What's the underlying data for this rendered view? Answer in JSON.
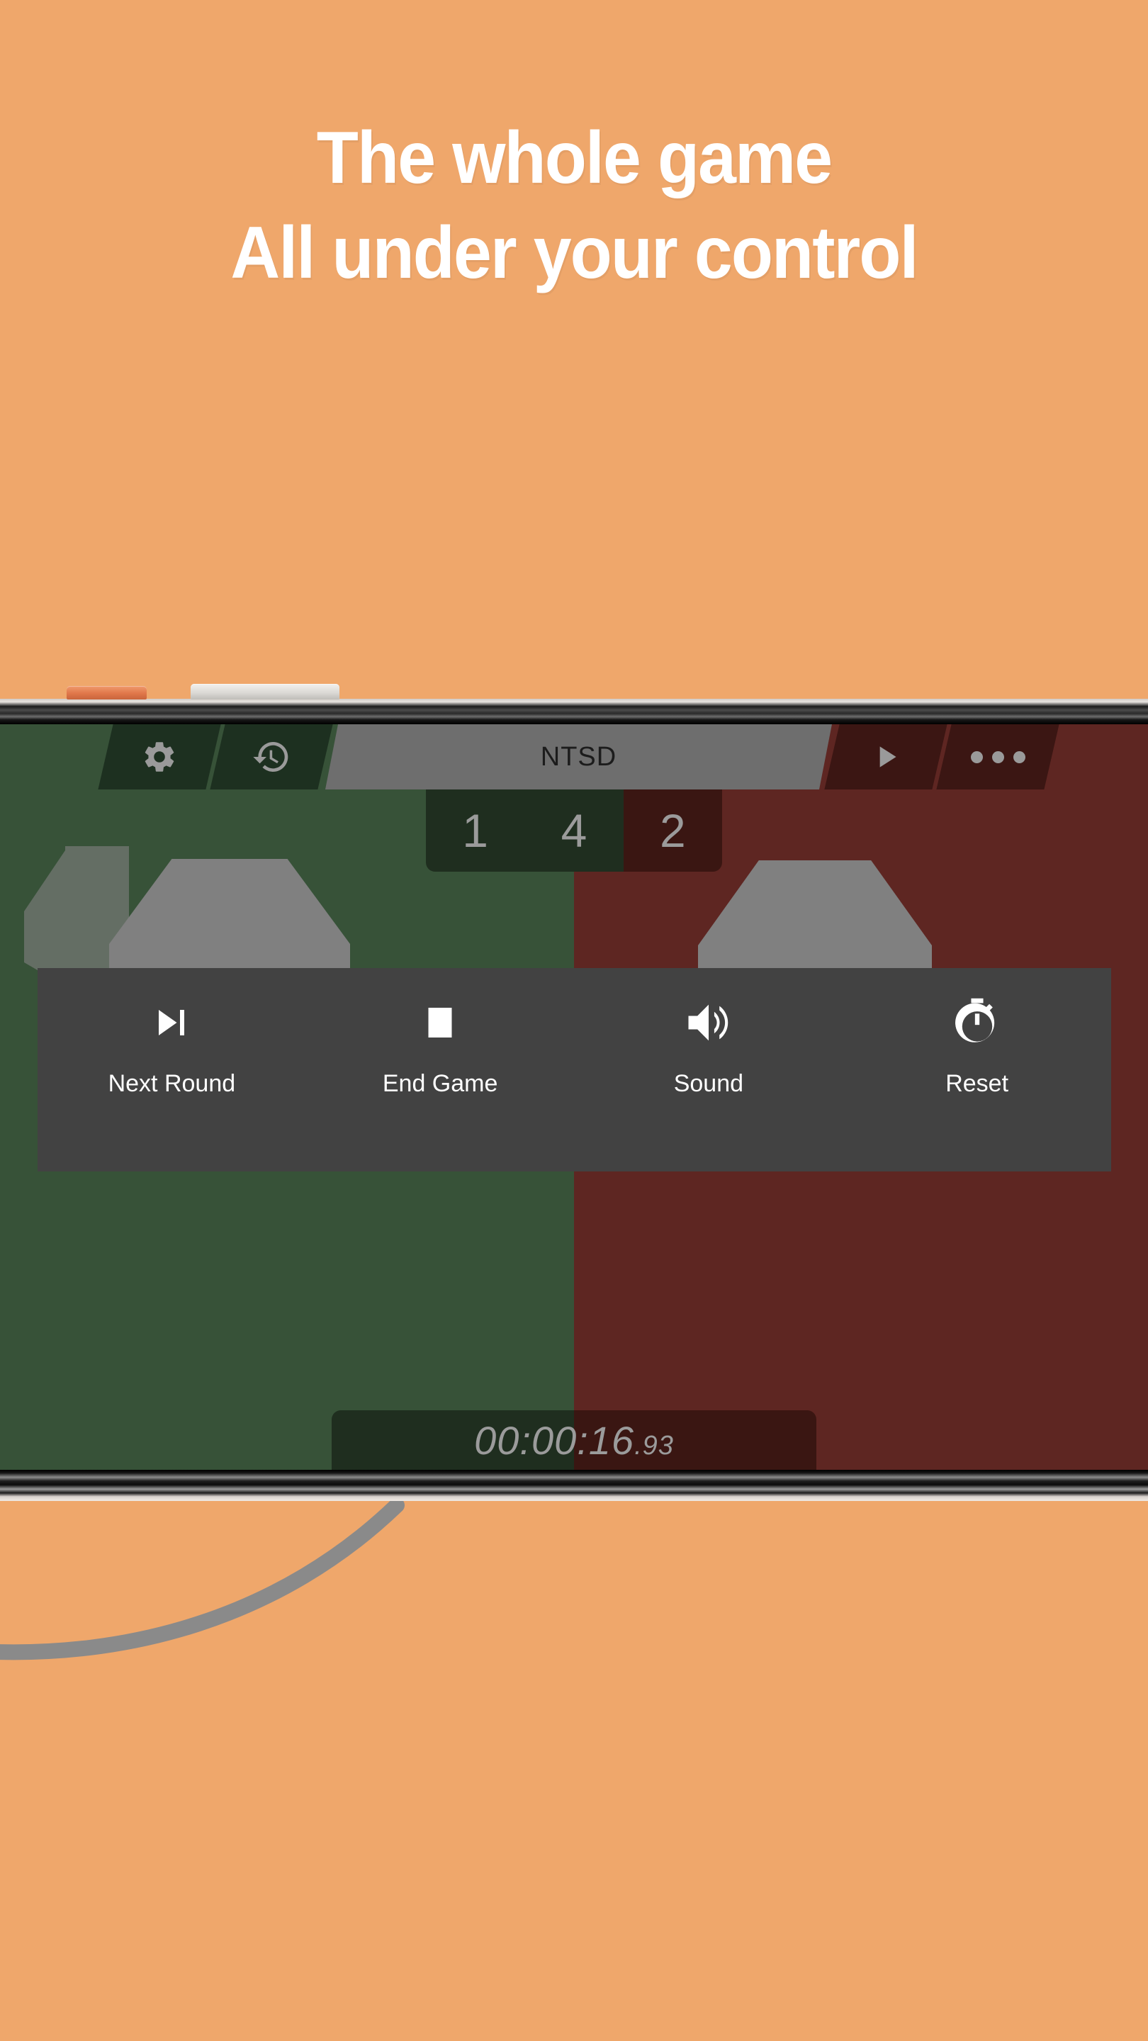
{
  "headline": {
    "line1": "The whole game",
    "line2": "All under your control"
  },
  "colors": {
    "background": "#efa76b",
    "team_green": "#375238",
    "team_red": "#5e2622",
    "overlay": "#424242",
    "title_plate": "#6e6e6e",
    "score_green": "#1f2e1f",
    "score_red": "#3a1612",
    "icon_gray": "#9a9a9a",
    "text_white": "#ffffff"
  },
  "device": {
    "power_button": "power-button",
    "volume_button": "volume-button"
  },
  "app": {
    "toolbar": {
      "settings_icon": "gear-icon",
      "history_icon": "history-icon",
      "title": "NTSD",
      "play_icon": "play-icon",
      "more_icon": "more-dots-icon"
    },
    "score": {
      "left": "1",
      "middle": "4",
      "right": "2"
    },
    "timer": {
      "main": "00:00:16",
      "fraction": ".93"
    },
    "controls": [
      {
        "label": "Next Round",
        "icon": "skip-next-icon"
      },
      {
        "label": "End Game",
        "icon": "stop-icon"
      },
      {
        "label": "Sound",
        "icon": "speaker-icon"
      },
      {
        "label": "Reset",
        "icon": "stopwatch-icon"
      }
    ]
  }
}
